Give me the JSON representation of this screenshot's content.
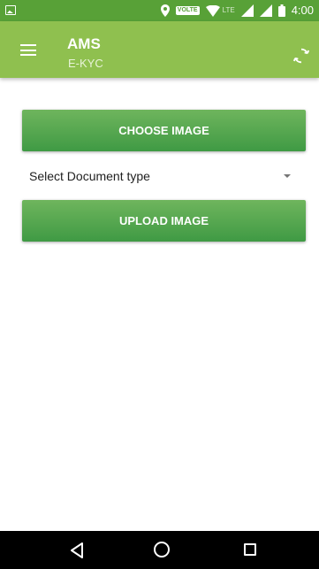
{
  "status_bar": {
    "volte_label": "VOLTE",
    "lte_label": "LTE",
    "time": "4:00",
    "icons": [
      "gallery-icon",
      "location-icon",
      "volte-icon",
      "wifi-icon",
      "signal-icon",
      "signal-icon",
      "battery-icon"
    ]
  },
  "app_bar": {
    "title": "AMS",
    "subtitle": "E-KYC",
    "menu_icon": "menu-icon",
    "refresh_icon": "sync-icon",
    "color": "#8fc04f"
  },
  "main": {
    "choose_button": "CHOOSE IMAGE",
    "document_select": {
      "selected": "Select Document type"
    },
    "upload_button": "UPLOAD IMAGE",
    "button_color": "#4ca24a"
  },
  "nav_bar": {
    "icons": [
      "back-icon",
      "home-icon",
      "recents-icon"
    ]
  }
}
